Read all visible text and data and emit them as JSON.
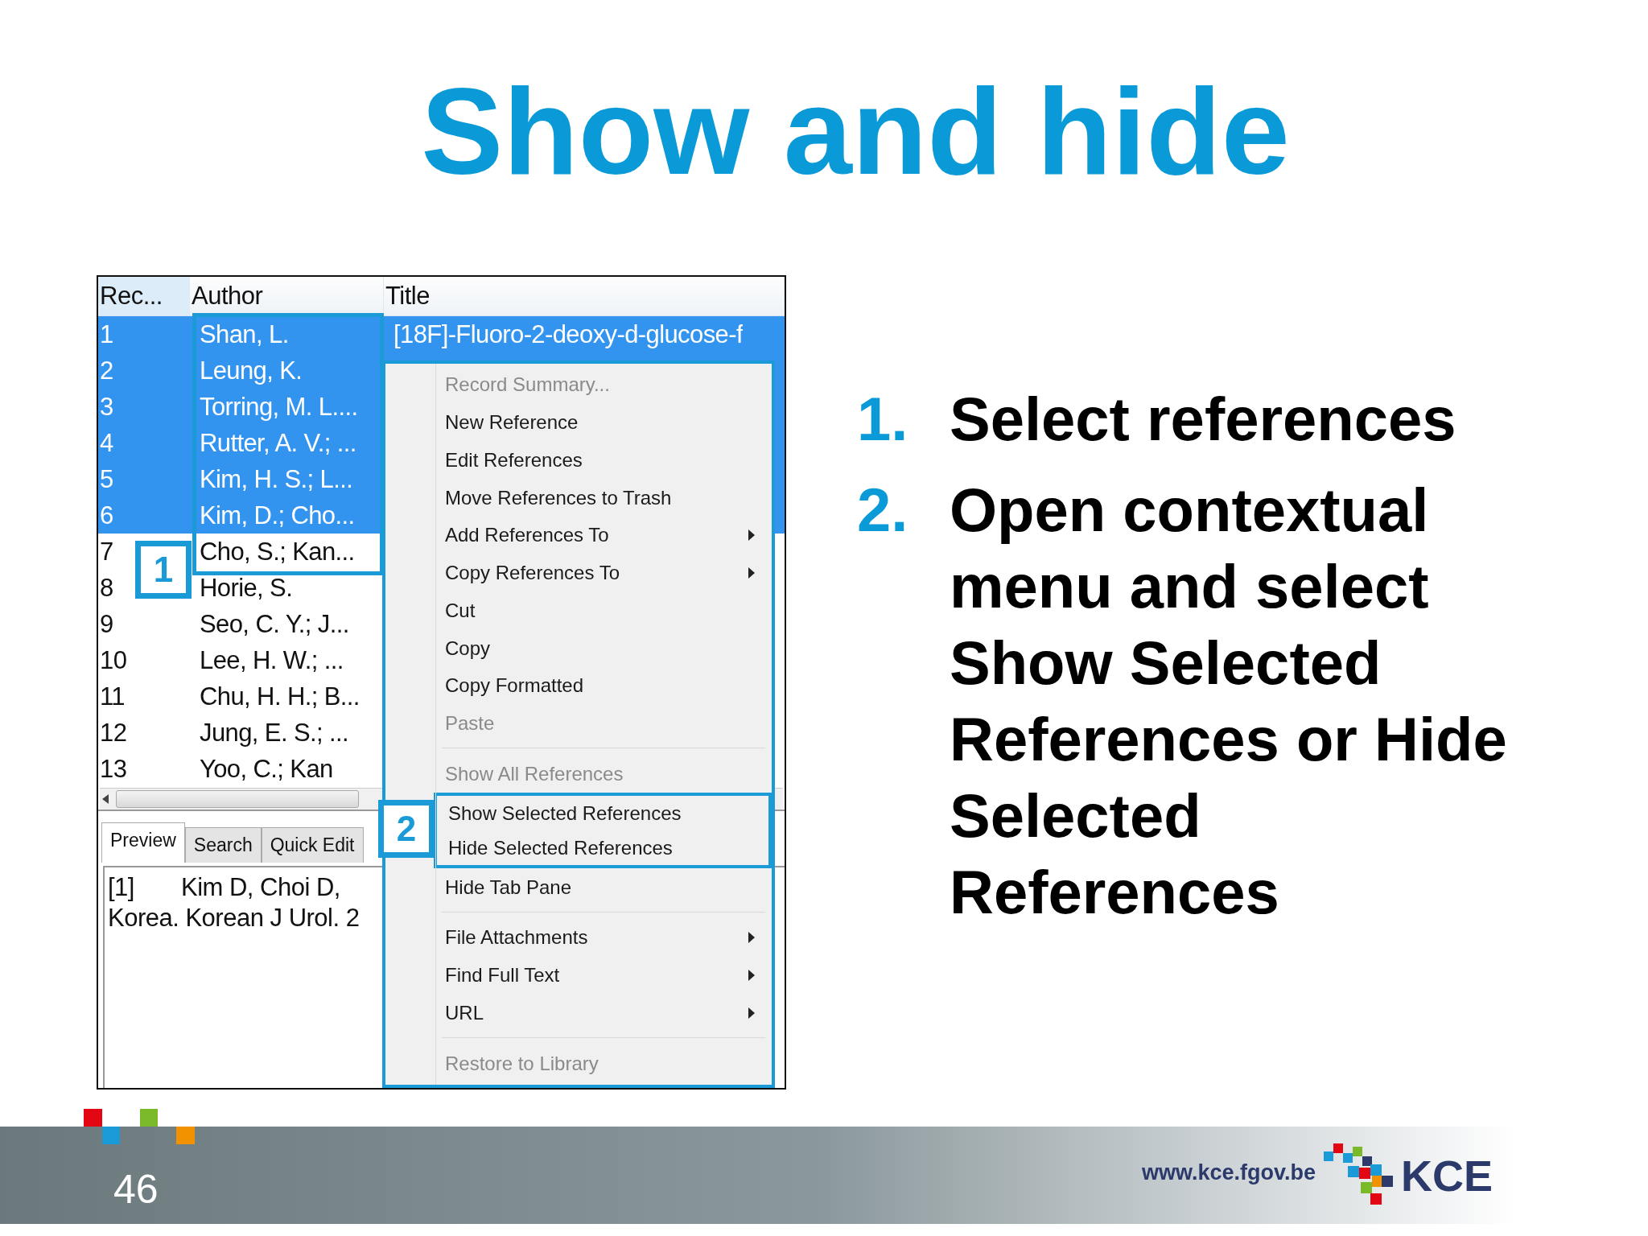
{
  "slide": {
    "title": "Show and hide",
    "steps": [
      {
        "number": "1.",
        "text": "Select references"
      },
      {
        "number": "2.",
        "text": "Open contextual menu and select Show Selected References or Hide Selected References"
      }
    ],
    "page_number": "46",
    "footer_url": "www.kce.fgov.be",
    "logo_text": "KCE"
  },
  "screenshot": {
    "columns": [
      "Rec...",
      "Author",
      "Title"
    ],
    "rows": [
      {
        "rec": "1",
        "author": "Shan, L.",
        "title": "[18F]-Fluoro-2-deoxy-d-glucose-f",
        "selected": true
      },
      {
        "rec": "2",
        "author": "Leung, K.",
        "selected": true
      },
      {
        "rec": "3",
        "author": "Torring, M. L....",
        "selected": true
      },
      {
        "rec": "4",
        "author": "Rutter, A. V.; ...",
        "selected": true
      },
      {
        "rec": "5",
        "author": "Kim, H. S.; L...",
        "selected": true
      },
      {
        "rec": "6",
        "author": "Kim, D.; Cho...",
        "selected": true
      },
      {
        "rec": "7",
        "author": "Cho, S.; Kan...",
        "selected": false
      },
      {
        "rec": "8",
        "author": "Horie, S.",
        "selected": false
      },
      {
        "rec": "9",
        "author": "Seo, C. Y.; J...",
        "selected": false
      },
      {
        "rec": "10",
        "author": "Lee, H. W.; ...",
        "selected": false
      },
      {
        "rec": "11",
        "author": "Chu, H. H.; B...",
        "selected": false
      },
      {
        "rec": "12",
        "author": "Jung, E. S.; ...",
        "selected": false
      },
      {
        "rec": "13",
        "author": "Yoo, C.; Kan",
        "selected": false
      }
    ],
    "tabs": [
      {
        "label": "Preview",
        "selected": true
      },
      {
        "label": "Search",
        "selected": false
      },
      {
        "label": "Quick Edit",
        "selected": false
      }
    ],
    "preview": [
      {
        "number": "[1]",
        "text": "Kim D, Choi D,"
      },
      {
        "text": "Korea. Korean J Urol. 2"
      }
    ],
    "context_menu": [
      {
        "kind": "item",
        "label": "Record Summary...",
        "disabled": true,
        "submenu": false
      },
      {
        "kind": "item",
        "label": "New Reference",
        "disabled": false,
        "submenu": false
      },
      {
        "kind": "item",
        "label": "Edit References",
        "disabled": false,
        "submenu": false
      },
      {
        "kind": "item",
        "label": "Move References to Trash",
        "disabled": false,
        "submenu": false
      },
      {
        "kind": "item",
        "label": "Add References To",
        "disabled": false,
        "submenu": true
      },
      {
        "kind": "item",
        "label": "Copy References To",
        "disabled": false,
        "submenu": true
      },
      {
        "kind": "item",
        "label": "Cut",
        "disabled": false,
        "submenu": false
      },
      {
        "kind": "item",
        "label": "Copy",
        "disabled": false,
        "submenu": false
      },
      {
        "kind": "item",
        "label": "Copy Formatted",
        "disabled": false,
        "submenu": false
      },
      {
        "kind": "item",
        "label": "Paste",
        "disabled": true,
        "submenu": false
      },
      {
        "kind": "separator"
      },
      {
        "kind": "item",
        "label": "Show All References",
        "disabled": true,
        "submenu": false
      },
      {
        "kind": "item",
        "label": "Show Selected References",
        "disabled": false,
        "submenu": false,
        "framed": true
      },
      {
        "kind": "item",
        "label": "Hide Selected References",
        "disabled": false,
        "submenu": false,
        "framed": true
      },
      {
        "kind": "item",
        "label": "Hide Tab Pane",
        "disabled": false,
        "submenu": false
      },
      {
        "kind": "separator"
      },
      {
        "kind": "item",
        "label": "File Attachments",
        "disabled": false,
        "submenu": true
      },
      {
        "kind": "item",
        "label": "Find Full Text",
        "disabled": false,
        "submenu": true
      },
      {
        "kind": "item",
        "label": "URL",
        "disabled": false,
        "submenu": true
      },
      {
        "kind": "separator"
      },
      {
        "kind": "item",
        "label": "Restore to Library",
        "disabled": true,
        "submenu": false
      }
    ],
    "callouts": [
      {
        "label": "1"
      },
      {
        "label": "2"
      }
    ]
  }
}
